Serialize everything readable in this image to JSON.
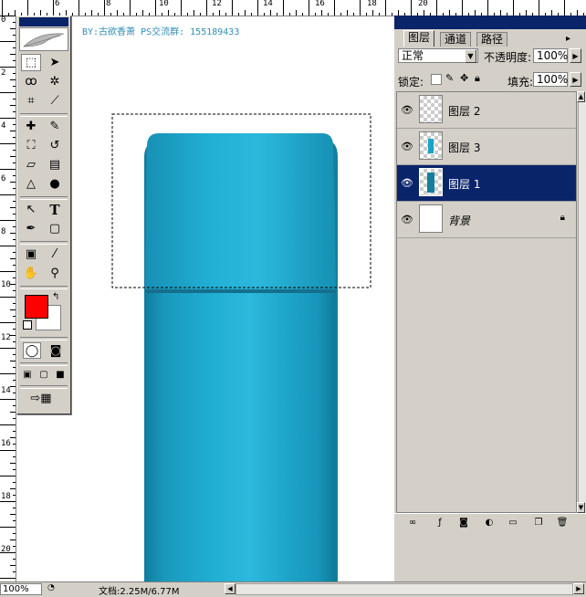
{
  "canvas": {
    "credit_text": "BY:古欲香萧 PS交流群: 155189433"
  },
  "rulers": {
    "top_labels": [
      "6",
      "8",
      "10",
      "12",
      "14",
      "16",
      "18",
      "20"
    ],
    "left_labels": [
      "0",
      "2",
      "4",
      "6",
      "8",
      "10",
      "12",
      "14",
      "16",
      "18",
      "20"
    ]
  },
  "toolbox": {
    "tools": [
      "rect-marquee",
      "move",
      "lasso",
      "magic-wand",
      "crop",
      "slice",
      "healing-brush",
      "brush",
      "clone-stamp",
      "history-brush",
      "eraser",
      "gradient",
      "blur",
      "dodge",
      "path-select",
      "type",
      "pen",
      "shape",
      "notes",
      "eyedropper",
      "hand",
      "zoom"
    ],
    "foreground_color": "#ff0000",
    "background_color": "#ffffff"
  },
  "layers_panel": {
    "tabs": [
      "图层",
      "通道",
      "路径"
    ],
    "blend_mode": "正常",
    "opacity_label": "不透明度:",
    "opacity_value": "100%",
    "lock_label": "锁定:",
    "fill_label": "填充:",
    "fill_value": "100%",
    "layers": [
      {
        "name": "图层 2",
        "visible": true,
        "selected": false,
        "locked": false
      },
      {
        "name": "图层 3",
        "visible": true,
        "selected": false,
        "locked": false
      },
      {
        "name": "图层 1",
        "visible": true,
        "selected": true,
        "locked": false
      },
      {
        "name": "背景",
        "visible": true,
        "selected": false,
        "locked": true
      }
    ]
  },
  "status_bar": {
    "zoom": "100%",
    "doc_info": "文档:2.25M/6.77M"
  },
  "colors": {
    "selection_highlight": "#0a246a",
    "bottle_main": "#1aa3c9",
    "bottle_dark": "#157f9e",
    "panel_bg": "#d4d0c8"
  }
}
